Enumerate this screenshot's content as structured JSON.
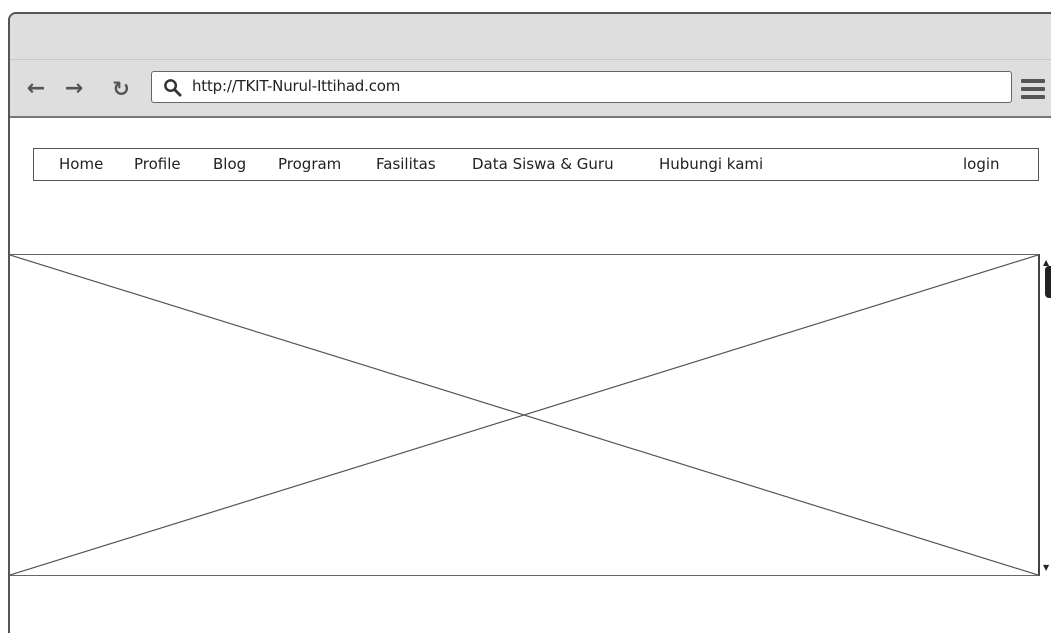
{
  "browser": {
    "url": "http://TKIT-Nurul-Ittihad.com",
    "back_icon": "back-arrow-icon",
    "forward_icon": "forward-arrow-icon",
    "reload_icon": "reload-icon",
    "search_icon": "search-icon",
    "menu_icon": "hamburger-menu-icon"
  },
  "nav": {
    "items": [
      "Home",
      "Profile",
      "Blog",
      "Program",
      "Fasilitas",
      "Data Siswa & Guru",
      "Hubungi kami"
    ],
    "login": "login"
  },
  "image_placeholder": {
    "type": "image-placeholder"
  },
  "colors": {
    "chrome": "#dedede",
    "border": "#555555",
    "text": "#222222"
  }
}
